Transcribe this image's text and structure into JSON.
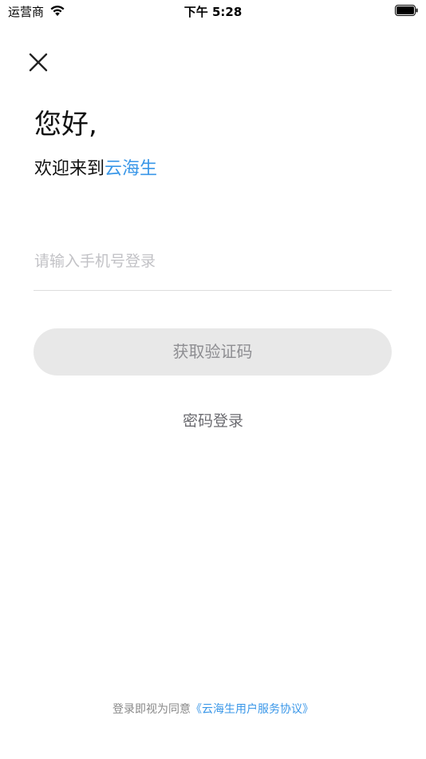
{
  "status_bar": {
    "carrier": "运营商",
    "time": "下午 5:28"
  },
  "header": {
    "close_icon": "close-icon"
  },
  "greeting": {
    "title": "您好,",
    "welcome_prefix": "欢迎来到",
    "app_name": "云海生"
  },
  "form": {
    "phone_placeholder": "请输入手机号登录",
    "phone_value": "",
    "get_code_label": "获取验证码",
    "password_login_label": "密码登录"
  },
  "footer": {
    "agreement_prefix": "登录即视为同意",
    "agreement_link": "《云海生用户服务协议》"
  },
  "colors": {
    "accent": "#3a97e8",
    "button_bg": "#e8e8e8",
    "button_text": "#8e8e92",
    "placeholder": "#c2c2c6"
  }
}
